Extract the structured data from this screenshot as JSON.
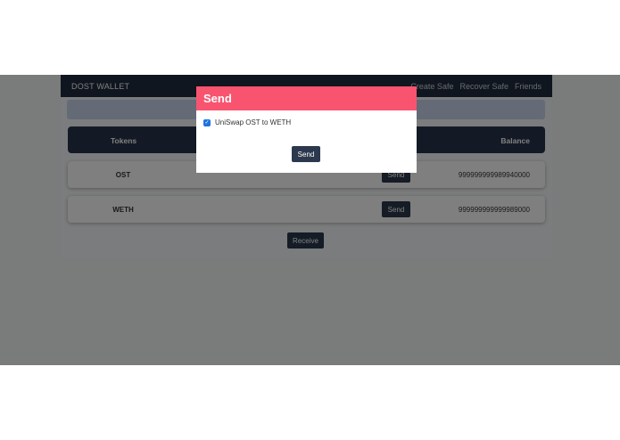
{
  "navbar": {
    "brand": "DOST WALLET",
    "links": [
      "Create Safe",
      "Recover Safe",
      "Friends"
    ]
  },
  "table": {
    "headers": {
      "tokens": "Tokens",
      "balance": "Balance"
    },
    "rows": [
      {
        "token": "OST",
        "send_label": "Send",
        "balance": "999999999989940000"
      },
      {
        "token": "WETH",
        "send_label": "Send",
        "balance": "999999999999989000"
      }
    ]
  },
  "receive_label": "Receive",
  "modal": {
    "title": "Send",
    "option_label": "UniSwap OST to WETH",
    "option_checked": true,
    "send_label": "Send"
  },
  "colors": {
    "navbar": "#212d3e",
    "modal_header": "#f9546f",
    "button": "#2b384d",
    "checkbox": "#1f74e0"
  }
}
